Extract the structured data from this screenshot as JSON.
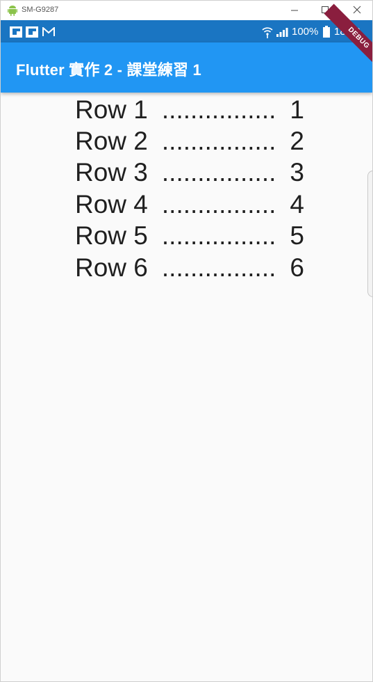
{
  "window": {
    "title": "SM-G9287"
  },
  "status_bar": {
    "battery_percent": "100%",
    "time": "18:38"
  },
  "app_bar": {
    "title": "Flutter 實作 2 - 課堂練習 1"
  },
  "debug_banner": {
    "label": "DEBUG"
  },
  "rows": [
    {
      "left": "Row 1",
      "leader": "................",
      "right": "1"
    },
    {
      "left": "Row 2",
      "leader": "................",
      "right": "2"
    },
    {
      "left": "Row 3",
      "leader": "................",
      "right": "3"
    },
    {
      "left": "Row 4",
      "leader": "................",
      "right": "4"
    },
    {
      "left": "Row 5",
      "leader": "................",
      "right": "5"
    },
    {
      "left": "Row 6",
      "leader": "................",
      "right": "6"
    }
  ],
  "colors": {
    "status_bar": "#1a75c2",
    "app_bar": "#2196f3",
    "debug_banner": "#8a1e3e",
    "background": "#fafafa"
  }
}
